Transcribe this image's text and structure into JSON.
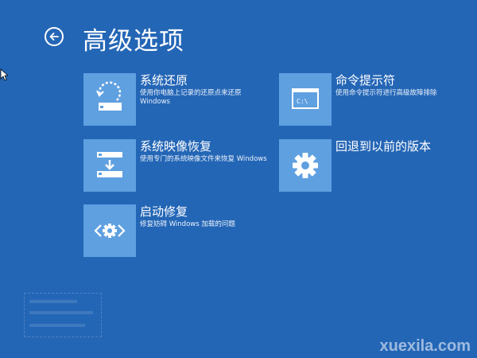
{
  "header": {
    "title": "高级选项",
    "back_icon": "back-arrow-icon"
  },
  "tiles": [
    {
      "title": "系统还原",
      "desc": "使用你电脑上记录的还原点来还原 Windows",
      "icon": "system-restore-icon"
    },
    {
      "title": "命令提示符",
      "desc": "使用命令提示符进行高级故障排除",
      "icon": "command-prompt-icon"
    },
    {
      "title": "系统映像恢复",
      "desc": "使用专门的系统映像文件来恢复 Windows",
      "icon": "system-image-icon"
    },
    {
      "title": "回退到以前的版本",
      "desc": "",
      "icon": "gear-icon"
    },
    {
      "title": "启动修复",
      "desc": "修复妨碍 Windows 加载的问题",
      "icon": "startup-repair-icon"
    }
  ],
  "watermark": "xuexila.com",
  "colors": {
    "background": "#2466b6",
    "tile_icon": "#5fa0e0",
    "text": "#ffffff"
  }
}
